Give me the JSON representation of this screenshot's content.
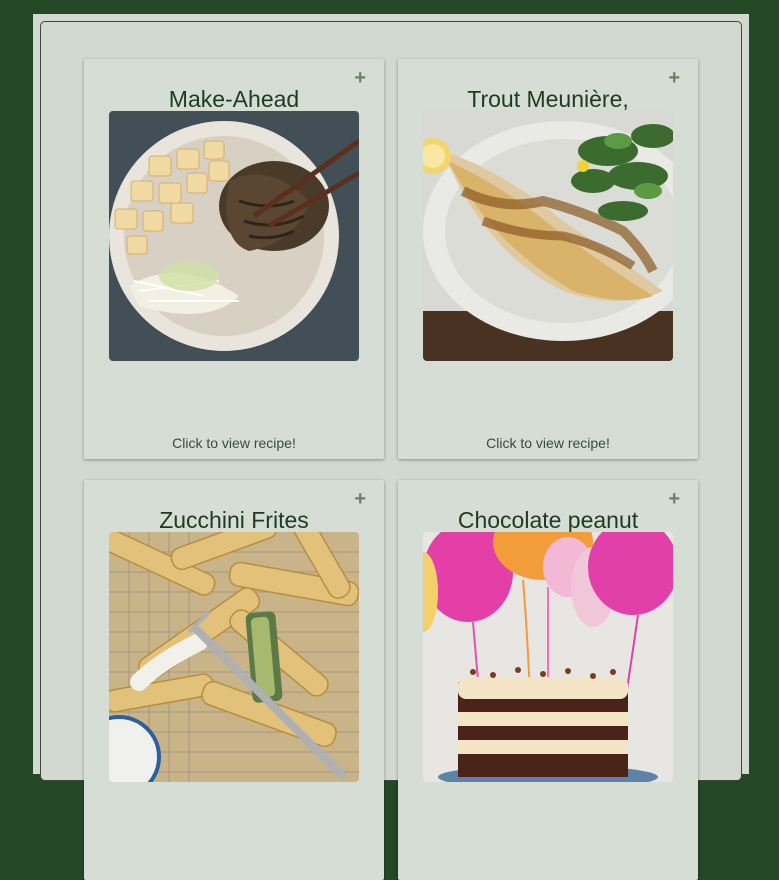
{
  "recipes": [
    {
      "title": "Make-Ahead",
      "image": "tofu-noodle-bowl-photo",
      "add_icon": "plus-icon",
      "link_text": "Click to view recipe!"
    },
    {
      "title": "Trout Meunière,",
      "image": "trout-fillet-plate-photo",
      "add_icon": "plus-icon",
      "link_text": "Click to view recipe!"
    },
    {
      "title": "Zucchini Frites",
      "image": "zucchini-frites-photo",
      "add_icon": "plus-icon",
      "link_text": ""
    },
    {
      "title": "Chocolate peanut",
      "image": "cake-balloons-photo",
      "add_icon": "plus-icon",
      "link_text": ""
    }
  ],
  "add_symbol": "+",
  "colors": {
    "background": "#244726",
    "panel": "#d2d9d0",
    "card": "#d6ddd4",
    "title_text": "#1f3a22"
  }
}
